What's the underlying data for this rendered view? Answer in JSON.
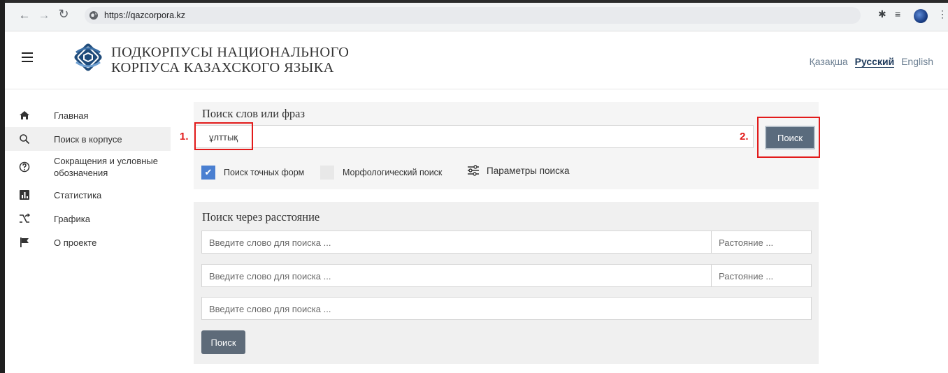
{
  "browser": {
    "url": "https://qazcorpora.kz",
    "back_icon": "arrow-left-icon",
    "forward_icon": "arrow-right-icon",
    "reload_icon": "reload-icon"
  },
  "header": {
    "title_line1": "ПОДКОРПУСЫ НАЦИОНАЛЬНОГО",
    "title_line2": "КОРПУСА КАЗАХСКОГО ЯЗЫКА",
    "languages": [
      "Қазақша",
      "Русский",
      "English"
    ],
    "active_language": "Русский"
  },
  "sidebar": {
    "items": [
      {
        "label": "Главная",
        "icon": "home-icon"
      },
      {
        "label": "Поиск в корпусе",
        "icon": "search-icon",
        "active": true
      },
      {
        "label": "Сокращения и условные обозначения",
        "icon": "help-circle-icon"
      },
      {
        "label": "Статистика",
        "icon": "bar-chart-icon"
      },
      {
        "label": "Графика",
        "icon": "shuffle-icon"
      },
      {
        "label": "О проекте",
        "icon": "flag-icon"
      }
    ]
  },
  "main": {
    "title": "Поиск слов или фраз",
    "input_value": "ұлттық",
    "search_label": "Поиск",
    "step1_label": "1.",
    "step2_label": "2.",
    "exact_forms_label": "Поиск точных форм",
    "exact_forms_checked": true,
    "morph_label": "Морфологический поиск",
    "morph_checked": false,
    "params_label": "Параметры поиска"
  },
  "distance": {
    "title": "Поиск через расстояние",
    "word_placeholder": "Введите слово для поиска ...",
    "distance_placeholder": "Растояние ...",
    "search_label": "Поиск"
  },
  "colors": {
    "accent_button": "#5a6b7d",
    "highlight_red": "#e21b1b",
    "checkbox_blue": "#4a7fd1"
  }
}
